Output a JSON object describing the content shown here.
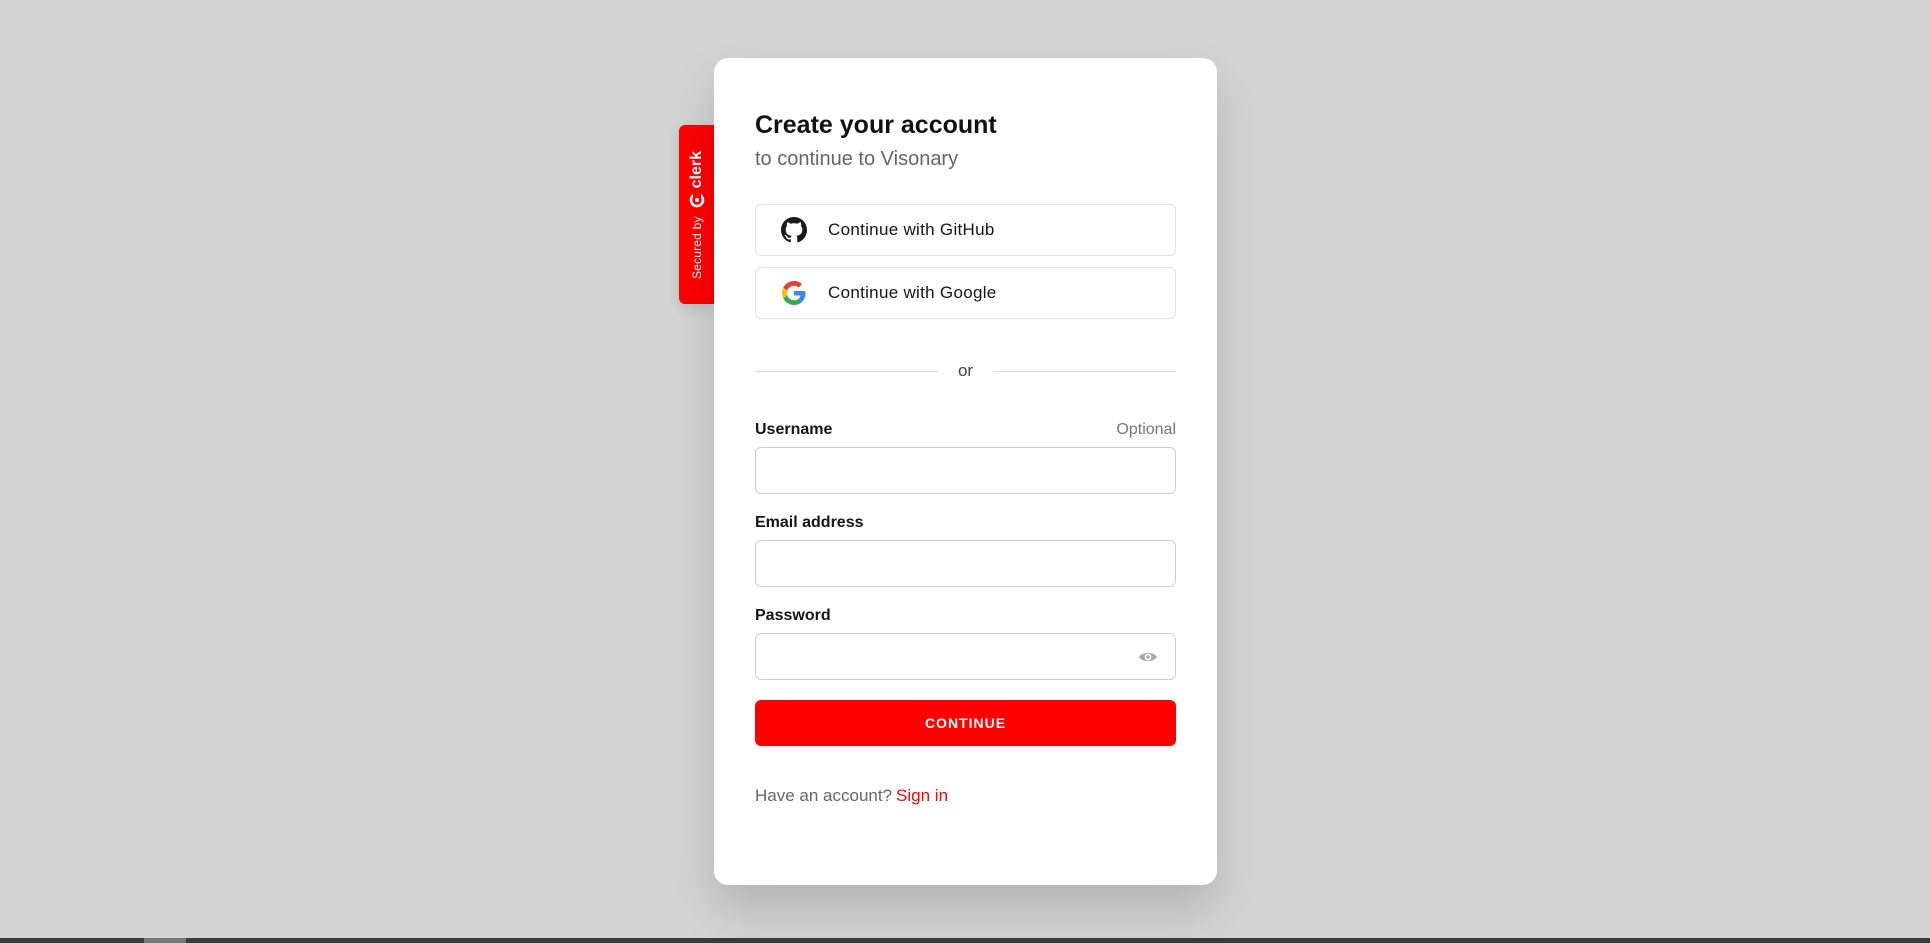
{
  "badge": {
    "secured_by": "Secured by",
    "brand": "clerk"
  },
  "card": {
    "title": "Create your account",
    "subtitle": "to continue to Visonary"
  },
  "social": [
    {
      "label": "Continue with GitHub",
      "icon": "github-icon"
    },
    {
      "label": "Continue with Google",
      "icon": "google-icon"
    }
  ],
  "divider": {
    "label": "or"
  },
  "form": {
    "username": {
      "label": "Username",
      "optional": "Optional",
      "value": ""
    },
    "email": {
      "label": "Email address",
      "value": ""
    },
    "password": {
      "label": "Password",
      "value": "",
      "toggle_icon": "eye-icon"
    },
    "submit_label": "CONTINUE"
  },
  "footer": {
    "prompt": "Have an account?",
    "link": "Sign in"
  },
  "colors": {
    "accent": "#ff0000",
    "background": "#d4d4d4",
    "card": "#ffffff"
  }
}
